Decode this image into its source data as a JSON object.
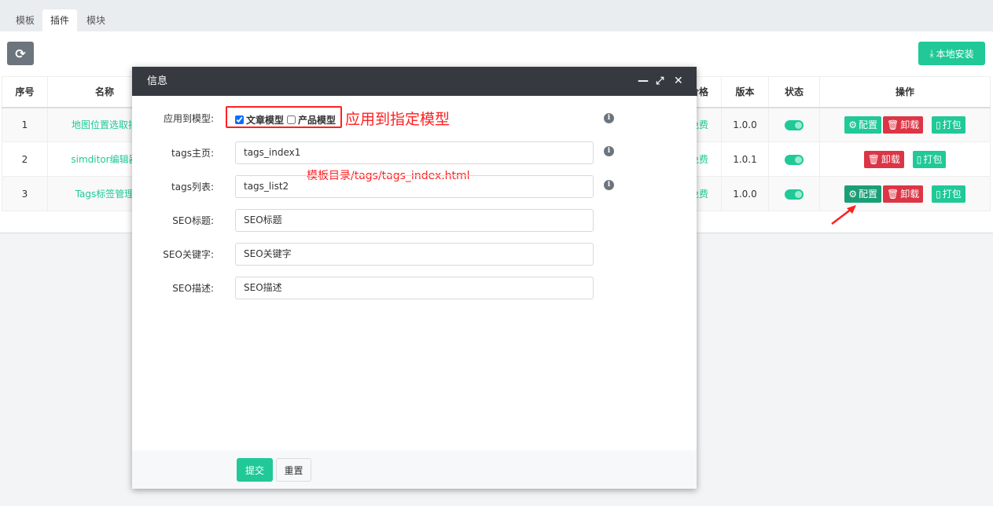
{
  "tabs": [
    {
      "label": "模板"
    },
    {
      "label": "插件",
      "active": true
    },
    {
      "label": "模块"
    }
  ],
  "toolbar": {
    "refresh_icon": "refresh-icon",
    "local_install": "本地安装",
    "download_icon": "download-icon"
  },
  "table": {
    "headers": [
      "序号",
      "名称",
      "价格",
      "版本",
      "状态",
      "操作"
    ],
    "rows": [
      {
        "index": "1",
        "name": "地图位置选取插",
        "price": "免费",
        "version": "1.0.0",
        "enabled": true,
        "actions": [
          "配置",
          "卸载",
          "打包"
        ]
      },
      {
        "index": "2",
        "name": "simditor编辑器",
        "price": "免费",
        "version": "1.0.1",
        "enabled": true,
        "actions": [
          "卸载",
          "打包"
        ]
      },
      {
        "index": "3",
        "name": "Tags标签管理",
        "price": "免费",
        "version": "1.0.0",
        "enabled": true,
        "actions": [
          "配置",
          "卸载",
          "打包"
        ]
      }
    ]
  },
  "modal": {
    "title": "信息",
    "fields": {
      "model": {
        "label": "应用到模型:",
        "options": [
          {
            "label": "文章模型",
            "checked": true
          },
          {
            "label": "产品模型",
            "checked": false
          }
        ]
      },
      "tags_index": {
        "label": "tags主页:",
        "value": "tags_index1"
      },
      "tags_list": {
        "label": "tags列表:",
        "value": "tags_list2"
      },
      "seo_title": {
        "label": "SEO标题:",
        "value": "SEO标题"
      },
      "seo_keywords": {
        "label": "SEO关键字:",
        "value": "SEO关键字"
      },
      "seo_desc": {
        "label": "SEO描述:",
        "value": "SEO描述"
      }
    },
    "submit": "提交",
    "reset": "重置"
  },
  "annotations": {
    "model_note": "应用到指定模型",
    "path_note": "模板目录/tags/tags_index.html"
  },
  "colors": {
    "primary": "#20c997",
    "danger": "#dc3545",
    "header": "#363a40",
    "annotation": "#ff2020"
  }
}
